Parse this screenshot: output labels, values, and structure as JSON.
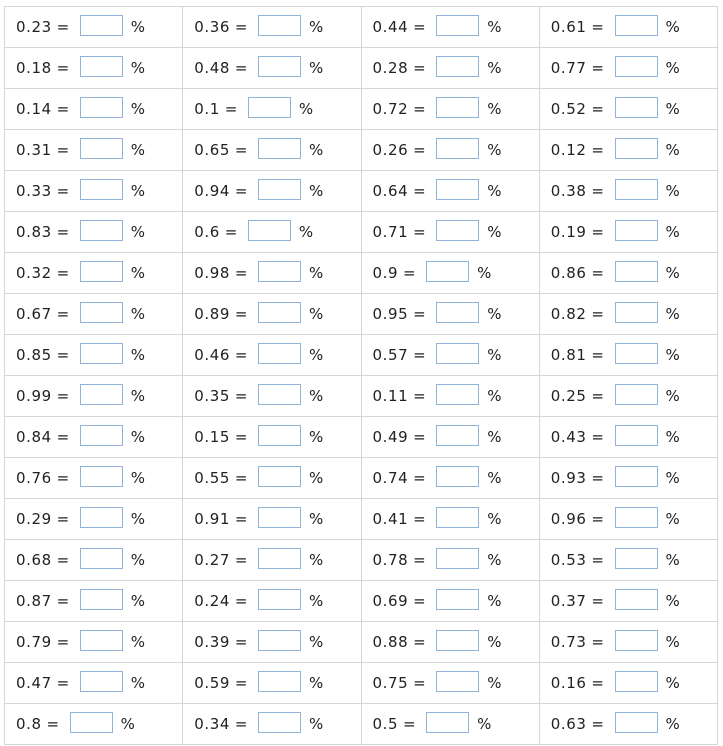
{
  "worksheet": {
    "equals_sign": "=",
    "percent_sign": "%",
    "rows": [
      [
        "0.23",
        "0.36",
        "0.44",
        "0.61"
      ],
      [
        "0.18",
        "0.48",
        "0.28",
        "0.77"
      ],
      [
        "0.14",
        "0.1",
        "0.72",
        "0.52"
      ],
      [
        "0.31",
        "0.65",
        "0.26",
        "0.12"
      ],
      [
        "0.33",
        "0.94",
        "0.64",
        "0.38"
      ],
      [
        "0.83",
        "0.6",
        "0.71",
        "0.19"
      ],
      [
        "0.32",
        "0.98",
        "0.9",
        "0.86"
      ],
      [
        "0.67",
        "0.89",
        "0.95",
        "0.82"
      ],
      [
        "0.85",
        "0.46",
        "0.57",
        "0.81"
      ],
      [
        "0.99",
        "0.35",
        "0.11",
        "0.25"
      ],
      [
        "0.84",
        "0.15",
        "0.49",
        "0.43"
      ],
      [
        "0.76",
        "0.55",
        "0.74",
        "0.93"
      ],
      [
        "0.29",
        "0.91",
        "0.41",
        "0.96"
      ],
      [
        "0.68",
        "0.27",
        "0.78",
        "0.53"
      ],
      [
        "0.87",
        "0.24",
        "0.69",
        "0.37"
      ],
      [
        "0.79",
        "0.39",
        "0.88",
        "0.73"
      ],
      [
        "0.47",
        "0.59",
        "0.75",
        "0.16"
      ],
      [
        "0.8",
        "0.34",
        "0.5",
        "0.63"
      ]
    ]
  }
}
